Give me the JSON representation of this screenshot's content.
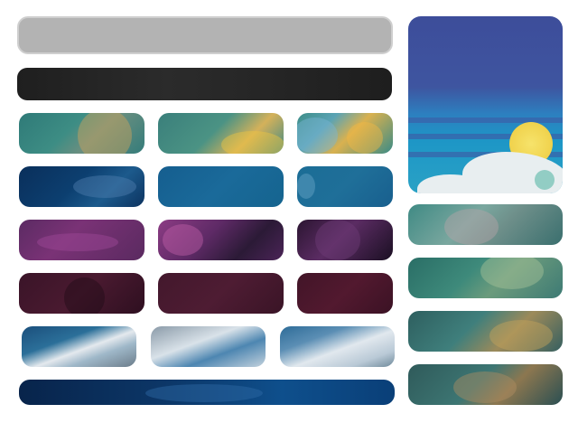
{
  "screen": {
    "search_bar": {
      "placeholder": ""
    },
    "toolbar": {
      "label": ""
    },
    "hero_image": {
      "name": "hero-image"
    },
    "tiles": [
      {
        "id": "tile-r1c1"
      },
      {
        "id": "tile-r1c2"
      },
      {
        "id": "tile-r1c3"
      },
      {
        "id": "tile-r2c1"
      },
      {
        "id": "tile-r2c2"
      },
      {
        "id": "tile-r2c3"
      },
      {
        "id": "tile-r3c1"
      },
      {
        "id": "tile-r3c2"
      },
      {
        "id": "tile-r3c3"
      },
      {
        "id": "tile-r4c1"
      },
      {
        "id": "tile-r4c2"
      },
      {
        "id": "tile-r4c3"
      },
      {
        "id": "tile-r5c1"
      },
      {
        "id": "tile-r5c2"
      },
      {
        "id": "tile-r5c3"
      },
      {
        "id": "tile-wide"
      }
    ],
    "side_tiles": [
      {
        "id": "side-tile-1"
      },
      {
        "id": "side-tile-2"
      },
      {
        "id": "side-tile-3"
      },
      {
        "id": "side-tile-4"
      }
    ]
  },
  "colors": {
    "search_bar": "#b3b3b3",
    "toolbar": "#232323",
    "hero_sky": "#3d4d9a",
    "hero_sun": "#f0d24c"
  }
}
